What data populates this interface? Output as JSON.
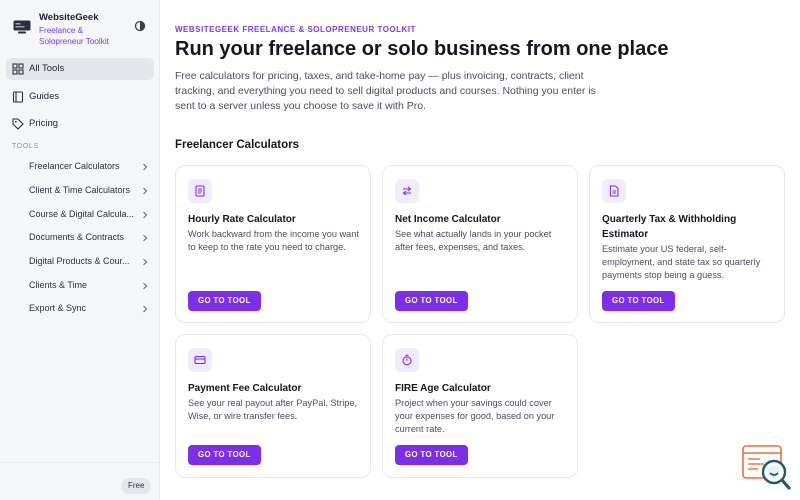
{
  "brand": {
    "name": "WebsiteGeek",
    "subtitle": "Freelance & Solopreneur Toolkit"
  },
  "nav": [
    {
      "label": "All Tools",
      "icon": "grid-icon",
      "active": true
    },
    {
      "label": "Guides",
      "icon": "book-icon",
      "active": false
    },
    {
      "label": "Pricing",
      "icon": "tag-icon",
      "active": false
    }
  ],
  "tools_section_label": "TOOLS",
  "tools": [
    {
      "label": "Freelancer Calculators"
    },
    {
      "label": "Client & Time Calculators"
    },
    {
      "label": "Course & Digital Calcula..."
    },
    {
      "label": "Documents & Contracts"
    },
    {
      "label": "Digital Products & Cour..."
    },
    {
      "label": "Clients & Time"
    },
    {
      "label": "Export & Sync"
    }
  ],
  "plan_badge": "Free",
  "main": {
    "eyebrow": "WEBSITEGEEK FREELANCE & SOLOPRENEUR TOOLKIT",
    "title": "Run your freelance or solo business from one place",
    "intro": "Free calculators for pricing, taxes, and take-home pay — plus invoicing, contracts, client tracking, and everything you need to sell digital products and courses. Nothing you enter is sent to a server unless you choose to save it with Pro.",
    "section_title": "Freelancer Calculators"
  },
  "cards": [
    {
      "title": "Hourly Rate Calculator",
      "desc": "Work backward from the income you want to keep to the rate you need to charge.",
      "button": "GO TO TOOL",
      "icon": "document-icon"
    },
    {
      "title": "Net Income Calculator",
      "desc": "See what actually lands in your pocket after fees, expenses, and taxes.",
      "button": "GO TO TOOL",
      "icon": "swap-icon"
    },
    {
      "title": "Quarterly Tax & Withholding Estimator",
      "desc": "Estimate your US federal, self-employment, and state tax so quarterly payments stop being a guess.",
      "button": "GO TO TOOL",
      "icon": "file-icon"
    },
    {
      "title": "Payment Fee Calculator",
      "desc": "See your real payout after PayPal, Stripe, Wise, or wire transfer fees.",
      "button": "GO TO TOOL",
      "icon": "card-icon"
    },
    {
      "title": "FIRE Age Calculator",
      "desc": "Project when your savings could cover your expenses for good, based on your current rate.",
      "button": "GO TO TOOL",
      "icon": "timer-icon"
    }
  ],
  "colors": {
    "accent": "#7c2ee8",
    "sidebar_bg": "#f5f6f8"
  }
}
